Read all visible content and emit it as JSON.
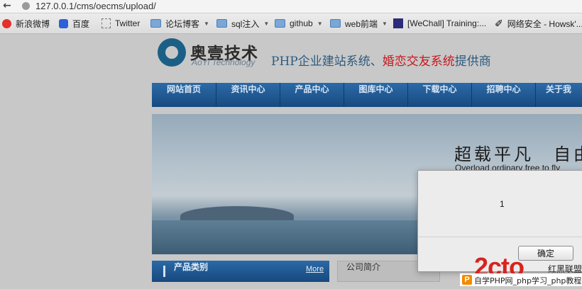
{
  "browser": {
    "url": "127.0.0.1/cms/oecms/upload/",
    "bookmarks": [
      {
        "label": "新浪微博",
        "icon": "weibo-icon",
        "folder": false
      },
      {
        "label": "百度",
        "icon": "baidu-icon",
        "folder": false
      },
      {
        "label": "Twitter",
        "icon": "blank-page-icon",
        "folder": false
      },
      {
        "label": "论坛博客",
        "icon": "folder-icon",
        "folder": true
      },
      {
        "label": "sql注入",
        "icon": "folder-icon",
        "folder": true
      },
      {
        "label": "github",
        "icon": "folder-icon",
        "folder": true
      },
      {
        "label": "web前端",
        "icon": "folder-icon",
        "folder": true
      },
      {
        "label": "[WeChall] Training:...",
        "icon": "wechall-icon",
        "folder": false
      },
      {
        "label": "网络安全 - Howsk'...",
        "icon": "howsk-icon",
        "folder": false
      }
    ]
  },
  "site": {
    "logo_cn": "奥壹技术",
    "logo_en": "AoYi Technology",
    "tagline_prefix": "PHP企业建站系统、",
    "tagline_highlight": "婚恋交友系统",
    "tagline_suffix": "提供商",
    "nav": [
      "网站首页",
      "资讯中心",
      "产品中心",
      "图库中心",
      "下载中心",
      "招聘中心",
      "关于我"
    ],
    "banner_title": "超载平凡　自由",
    "banner_subtitle": "Overload ordinary free to fly",
    "category_title": "产品类别",
    "category_more": "More",
    "about_title": "公司简介"
  },
  "dialog": {
    "message": "1",
    "ok_label": "确定"
  },
  "watermark": {
    "big": "2cto",
    "small": "红黑联盟",
    "badge": "P",
    "strip_text": "自学PHP网_php学习_php教程"
  },
  "colors": {
    "nav_blue": "#1f5a94",
    "tagline_red": "#c8161d",
    "watermark_red": "#d8231e"
  }
}
